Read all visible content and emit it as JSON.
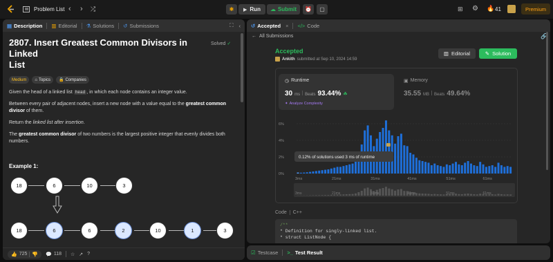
{
  "topbar": {
    "problem_list": "Problem List",
    "run": "Run",
    "submit": "Submit",
    "streak": "41",
    "premium": "Premium"
  },
  "left_tabs": [
    "Description",
    "Editorial",
    "Solutions",
    "Submissions"
  ],
  "problem": {
    "title_line1": "2807. Insert Greatest Common Divisors in Linked",
    "title_line2": "List",
    "solved": "Solved",
    "difficulty": "Medium",
    "topics": "Topics",
    "companies": "Companies",
    "p1a": "Given the head of a linked list ",
    "p1code": "head",
    "p1b": ", in which each node contains an integer value.",
    "p2a": "Between every pair of adjacent nodes, insert a new node with a value equal to the ",
    "p2b": "greatest common divisor",
    "p2c": " of them.",
    "p3a": "Return the ",
    "p3b": "linked list after insertion",
    "p3c": ".",
    "p4a": "The ",
    "p4b": "greatest common divisor",
    "p4c": " of two numbers is the largest positive integer that evenly divides both numbers.",
    "example": "Example 1:",
    "row1": [
      "18",
      "6",
      "10",
      "3"
    ],
    "row2": [
      "18",
      "6",
      "6",
      "2",
      "10",
      "1",
      "3"
    ]
  },
  "footer": {
    "likes": "725",
    "comments": "118"
  },
  "right_tabs": {
    "accepted": "Accepted",
    "code": "Code"
  },
  "all_submissions": "All Submissions",
  "result": {
    "status": "Accepted",
    "user": "Ankith",
    "submitted": "submitted at Sep 10, 2024 14:59",
    "editorial": "Editorial",
    "solution": "Solution"
  },
  "runtime": {
    "label": "Runtime",
    "value": "30",
    "unit": "ms",
    "beats": "Beats",
    "pct": "93.44%",
    "analyze": "Analyze Complexity"
  },
  "memory": {
    "label": "Memory",
    "value": "35.55",
    "unit": "MB",
    "beats": "Beats",
    "pct": "49.64%"
  },
  "chart_data": {
    "type": "bar",
    "y_ticks": [
      "6%",
      "4%",
      "2%",
      "0%"
    ],
    "x_ticks": [
      "3ms",
      "21ms",
      "31ms",
      "41ms",
      "51ms",
      "61ms"
    ],
    "tooltip": "0.12% of solutions used 3 ms of runtime",
    "values": [
      0.12,
      0.1,
      0.12,
      0.15,
      0.2,
      0.25,
      0.3,
      0.35,
      0.4,
      0.45,
      0.5,
      0.6,
      0.7,
      0.8,
      0.8,
      0.9,
      1.0,
      1.1,
      1.2,
      1.6,
      2.5,
      3.5,
      5.2,
      5.8,
      4.6,
      3.3,
      4.2,
      5.0,
      5.5,
      6.4,
      5.2,
      4.6,
      3.6,
      4.5,
      4.8,
      3.4,
      3.3,
      2.5,
      2.3,
      1.9,
      1.6,
      1.5,
      1.4,
      1.3,
      1.0,
      1.2,
      1.0,
      0.9,
      0.8,
      1.1,
      1.0,
      1.2,
      1.4,
      1.1,
      1.0,
      1.3,
      1.5,
      1.2,
      1.0,
      0.9,
      1.4,
      1.1,
      0.8,
      0.9,
      1.0,
      0.8,
      1.3,
      1.0,
      0.8,
      0.9,
      0.8
    ],
    "ylim": [
      0,
      7
    ]
  },
  "code_section": {
    "label": "Code",
    "lang": "C++",
    "lines": [
      "/**",
      " * Definition for singly-linked list.",
      " * struct ListNode {"
    ]
  },
  "bottom_tabs": {
    "testcase": "Testcase",
    "result": "Test Result"
  }
}
